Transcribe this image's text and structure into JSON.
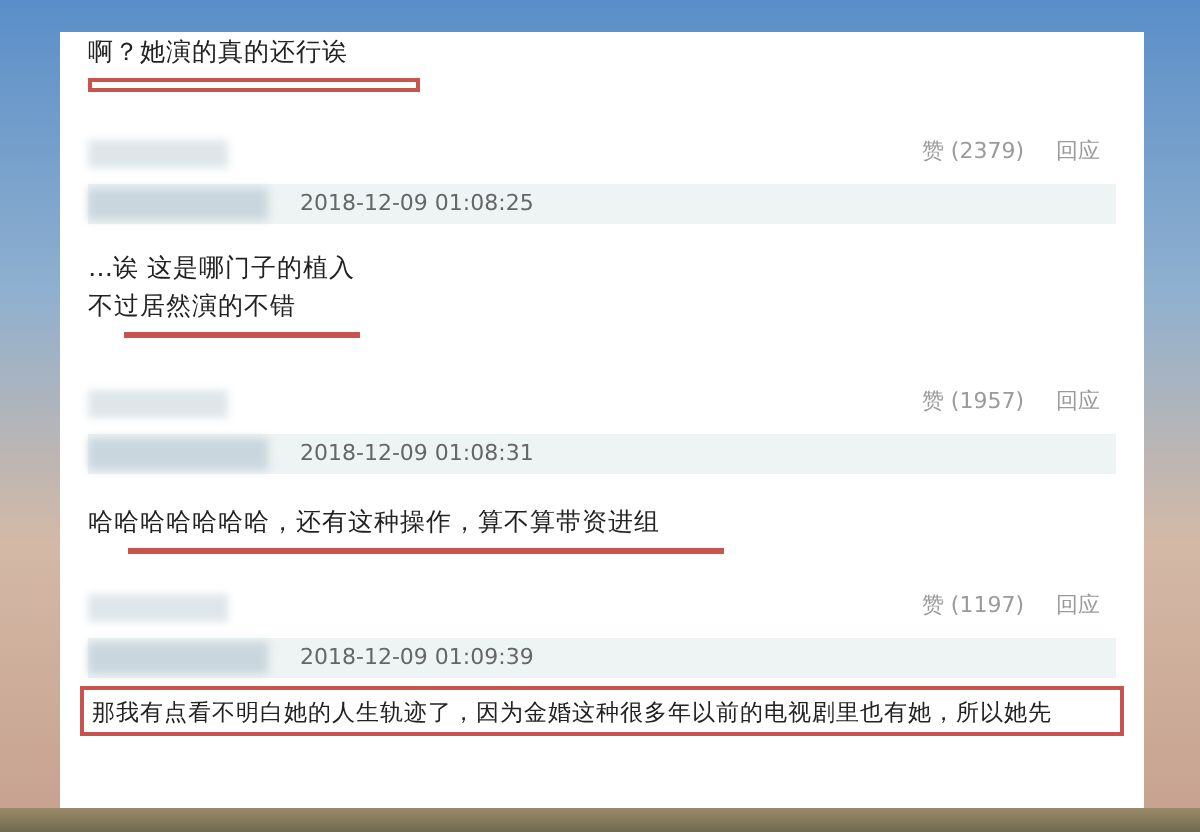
{
  "comments": [
    {
      "kind": "text",
      "lines": [
        "啊？她演的真的还行诶"
      ]
    },
    {
      "kind": "outline"
    },
    {
      "kind": "meta",
      "likes": "赞 (2379)",
      "reply": "回应",
      "timestamp": "2018-12-09 01:08:25"
    },
    {
      "kind": "text",
      "lines": [
        "…诶 这是哪门子的植入",
        "不过居然演的不错"
      ]
    },
    {
      "kind": "underline"
    },
    {
      "kind": "meta",
      "likes": "赞 (1957)",
      "reply": "回应",
      "timestamp": "2018-12-09 01:08:31"
    },
    {
      "kind": "text",
      "lines": [
        "哈哈哈哈哈哈哈，还有这种操作，算不算带资进组"
      ]
    },
    {
      "kind": "underline"
    },
    {
      "kind": "meta",
      "likes": "赞 (1197)",
      "reply": "回应",
      "timestamp": "2018-12-09 01:09:39"
    },
    {
      "kind": "boxed",
      "lines": [
        "那我有点看不明白她的人生轨迹了，因为金婚这种很多年以前的电视剧里也有她，所以她先"
      ]
    }
  ]
}
